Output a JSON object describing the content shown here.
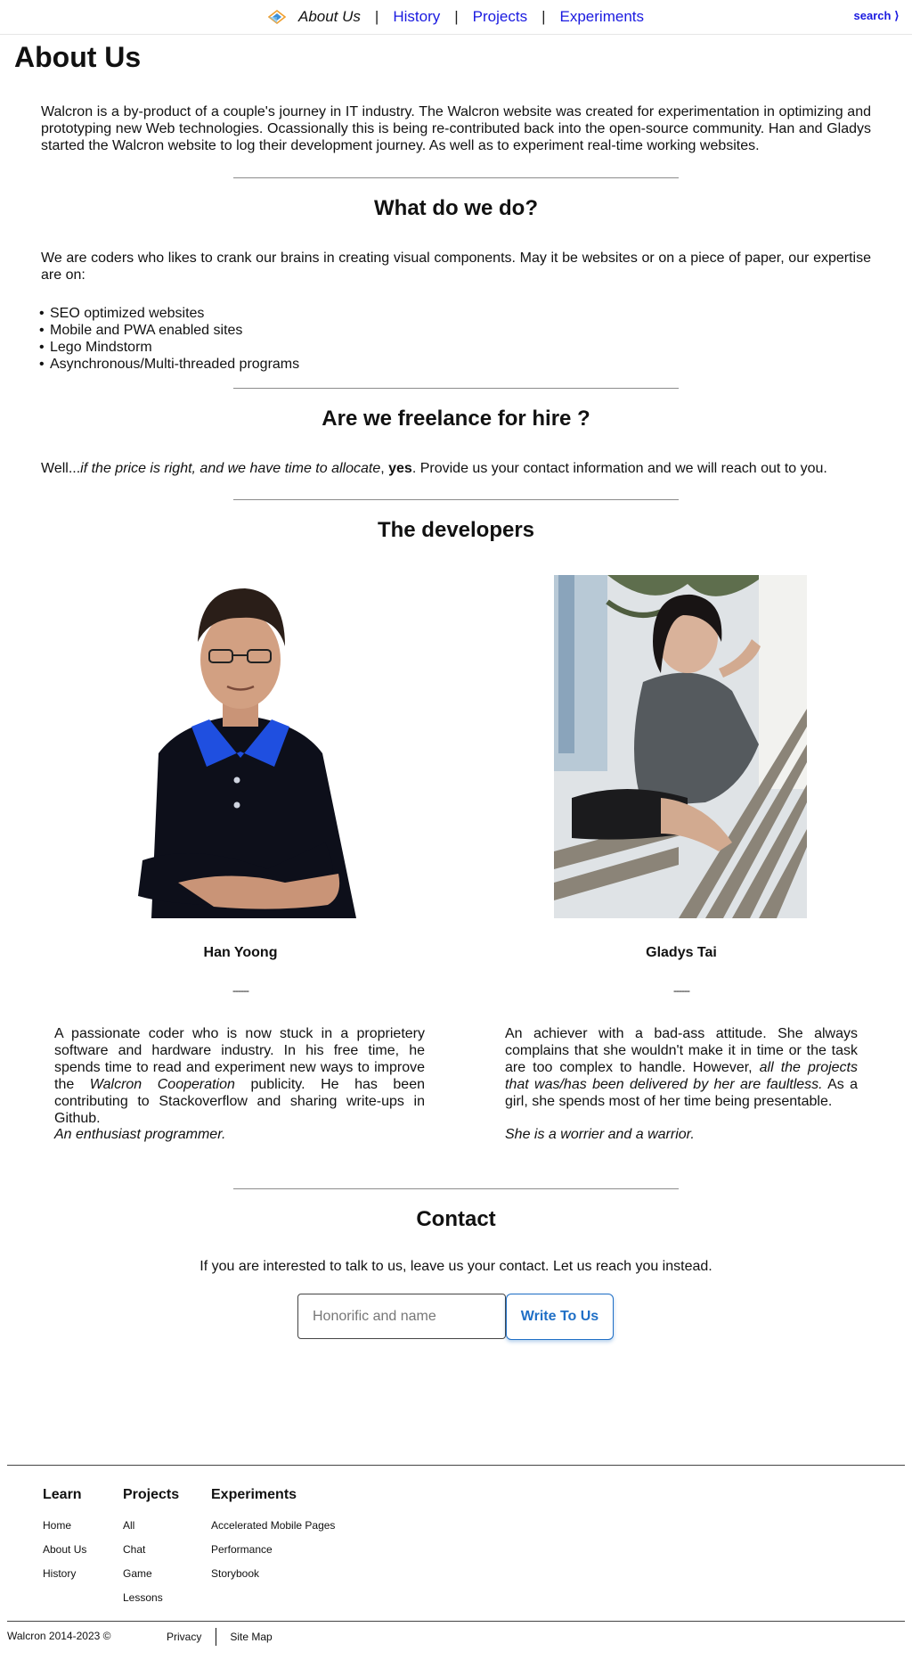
{
  "nav": {
    "items": [
      "About Us",
      "History",
      "Projects",
      "Experiments"
    ],
    "separator": "|",
    "search_label": "search ⟩"
  },
  "about": {
    "title": "About Us",
    "intro": "Walcron is a by-product of a couple's journey in IT industry. The Walcron website was created for experimentation in optimizing and prototyping new Web technologies. Ocassionally this is being re-contributed back into the open-source community. Han and Gladys started the Walcron website to log their development journey. As well as to experiment real-time working websites."
  },
  "whatwedo": {
    "title": "What do we do?",
    "intro": "We are coders who likes to crank our brains in creating visual components. May it be websites or on a piece of paper, our expertise are on:",
    "items": [
      "SEO optimized websites",
      "Mobile and PWA enabled sites",
      "Lego Mindstorm",
      "Asynchronous/Multi-threaded programs"
    ]
  },
  "freelance": {
    "title": "Are we freelance for hire ?",
    "prefix": "Well...",
    "emphasis": "if the price is right, and we have time to allocate",
    "comma": ",",
    "answer": "yes",
    "suffix": ". Provide us your contact information and we will reach out to you."
  },
  "developers": {
    "title": "The developers",
    "people": [
      {
        "name": "Han Yoong",
        "dash": "------",
        "bio_part1": "A passionate coder who is now stuck in a proprietery software and hardware industry. In his free time, he spends time to read and experiment new ways to improve the ",
        "bio_em": "Walcron Cooperation",
        "bio_part2": " publicity. He has been contributing to Stackoverflow and sharing write-ups in Github.",
        "tagline": "An enthusiast programmer."
      },
      {
        "name": "Gladys Tai",
        "dash": "------",
        "bio_part1": "An achiever with a bad-ass attitude. She always complains that she wouldn't make it in time or the task are too complex to handle. However, ",
        "bio_em": "all the projects that was/has been delivered by her are faultless.",
        "bio_part2": " As a girl, she spends most of her time being presentable.",
        "tagline": "She is a worrier and a warrior."
      }
    ]
  },
  "contact": {
    "title": "Contact",
    "text": "If you are interested to talk to us, leave us your contact. Let us reach you instead.",
    "input_placeholder": "Honorific and name",
    "button_label": "Write To Us"
  },
  "footer": {
    "columns": [
      {
        "heading": "Learn",
        "links": [
          "Home",
          "About Us",
          "History"
        ]
      },
      {
        "heading": "Projects",
        "links": [
          "All",
          "Chat",
          "Game",
          "Lessons"
        ]
      },
      {
        "heading": "Experiments",
        "links": [
          "Accelerated Mobile Pages",
          "Performance",
          "Storybook"
        ]
      }
    ],
    "copyright": "Walcron 2014-2023 ©",
    "bottom_links": [
      "Privacy",
      "Site Map"
    ]
  },
  "colors": {
    "nav_link": "#1a1ae0",
    "accent": "#1f6fc6"
  }
}
